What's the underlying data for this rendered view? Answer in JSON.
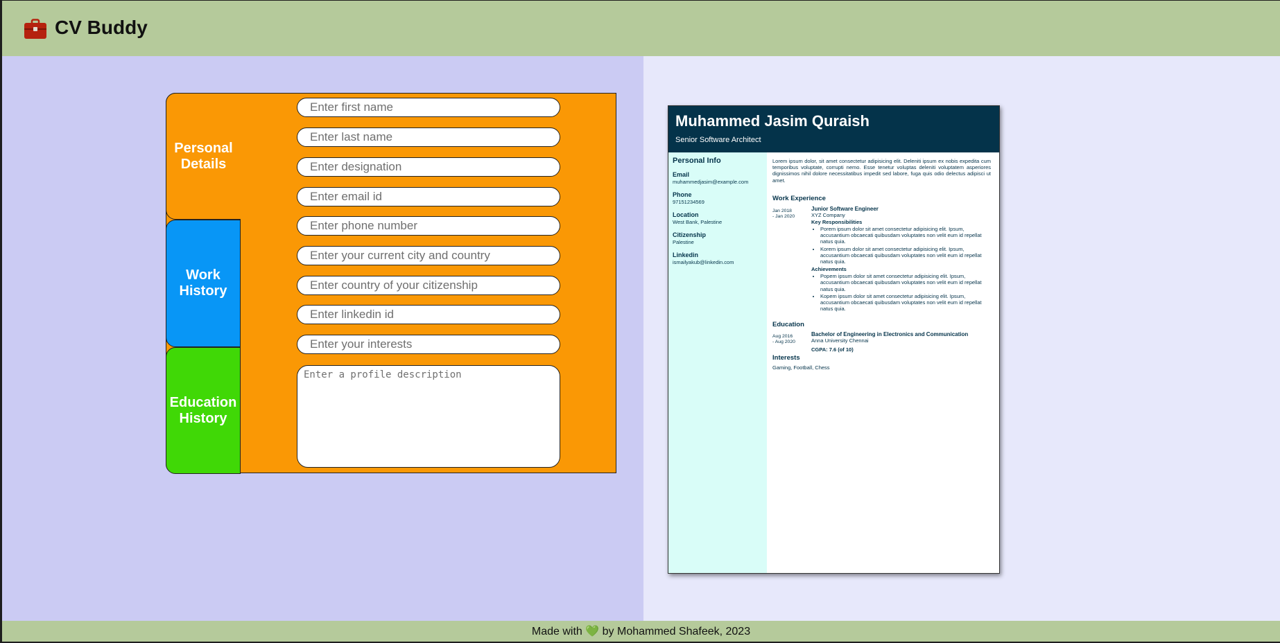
{
  "app": {
    "title": "CV Buddy",
    "logo_icon": "briefcase-icon"
  },
  "tabs": {
    "personal": {
      "line1": "Personal",
      "line2": "Details"
    },
    "work": {
      "line1": "Work",
      "line2": "History"
    },
    "education": {
      "line1": "Education",
      "line2": "History"
    }
  },
  "form": {
    "first_name": "Enter first name",
    "last_name": "Enter last name",
    "designation": "Enter designation",
    "email": "Enter email id",
    "phone": "Enter phone number",
    "city": "Enter your current city and country",
    "citizenship": "Enter country of your citizenship",
    "linkedin": "Enter linkedin id",
    "interests": "Enter your interests",
    "description": "Enter a profile description"
  },
  "cv": {
    "name": "Muhammed Jasim Quraish",
    "role": "Senior Software Architect",
    "personal_info_title": "Personal Info",
    "email_label": "Email",
    "email": "muhammedjasim@example.com",
    "phone_label": "Phone",
    "phone": "97151234569",
    "location_label": "Location",
    "location": "West Bank, Palestine",
    "citizenship_label": "Citizenship",
    "citizenship": "Palestine",
    "linkedin_label": "Linkedin",
    "linkedin": "ismailyakub@linkedin.com",
    "summary": "Lorem ipsum dolor, sit amet consectetur adipisicing elit. Deleniti ipsum ex nobis expedita cum temporibus voluptate, corrupti nemo. Esse tenetur voluptas deleniti voluptatem asperiores dignissimos nihil dolore necessitatibus impedit sed labore, fuga quis odio delectus adipisci ut amet.",
    "work_title": "Work Experience",
    "job": {
      "date_from": "Jan 2018",
      "date_to": "- Jan 2020",
      "title": "Junior Software Engineer",
      "company": "XYZ Company",
      "resp_title": "Key Responsibilities",
      "resp1": "Porem ipsum dolor sit amet consectetur adipisicing elit. Ipsum, accusantium obcaecati quibusdam voluptates non velit eum id repellat natus quia.",
      "resp2": "Korem ipsum dolor sit amet consectetur adipisicing elit. Ipsum, accusantium obcaecati quibusdam voluptates non velit eum id repellat natus quia.",
      "ach_title": "Achievements",
      "ach1": "Popem ipsum dolor sit amet consectetur adipisicing elit. Ipsum, accusantium obcaecati quibusdam voluptates non velit eum id repellat natus quia.",
      "ach2": "Kopem ipsum dolor sit amet consectetur adipisicing elit. Ipsum, accusantium obcaecati quibusdam voluptates non velit eum id repellat natus quia."
    },
    "education_title": "Education",
    "edu": {
      "date_from": "Aug 2016",
      "date_to": "- Aug 2020",
      "degree": "Bachelor of Engineering in Electronics and Communication",
      "school": "Anna University Chennai",
      "cgpa": "CGPA: 7.6 (of 10)"
    },
    "interests_title": "Interests",
    "interests": "Gaming, Football, Chess"
  },
  "footer": {
    "before": "Made with",
    "heart": "💚",
    "after": "by Mohammed Shafeek, 2023"
  },
  "colors": {
    "topbar": "#b5ca9b",
    "editor_bg": "#cbcbf3",
    "preview_bg": "#e7e8fb",
    "form_orange": "#fa9805",
    "work_blue": "#0896f6",
    "edu_green": "#40d806",
    "cv_header": "#04334a",
    "cv_sidebar": "#d9fdf8"
  }
}
